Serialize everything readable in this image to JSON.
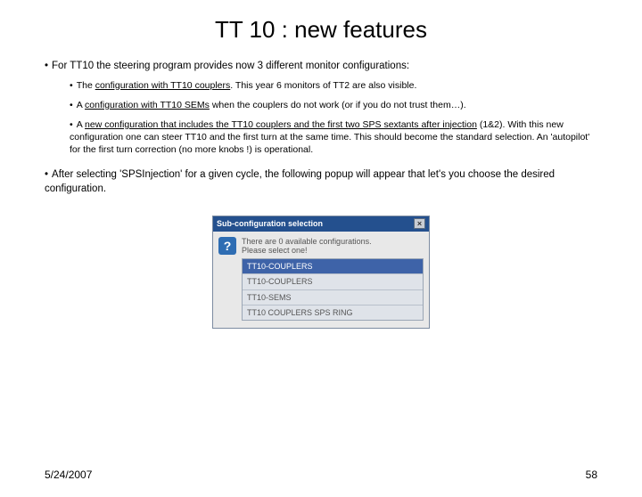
{
  "title": "TT 10 : new features",
  "bullets": {
    "b1": "For TT10 the steering program provides now 3 different monitor configurations:",
    "b1a_pre": "The ",
    "b1a_u": "configuration with TT10 couplers",
    "b1a_post": ". This year 6 monitors of TT2 are also visible.",
    "b1b_pre": "A ",
    "b1b_u": "configuration with TT10 SEMs",
    "b1b_post": " when the couplers do not work (or if you do not trust them…).",
    "b1c_pre": "A ",
    "b1c_u": "new configuration that includes the TT10 couplers and the first two SPS sextants after injection",
    "b1c_post": " (1&2). With this new configuration one can steer TT10 and the first turn at the same time. This should become the standard selection. An 'autopilot' for the first turn correction (no more knobs !) is operational.",
    "b2": "After selecting 'SPSInjection' for a given cycle, the following popup will appear that let's you choose the desired configuration."
  },
  "dialog": {
    "title": "Sub-configuration selection",
    "close": "×",
    "qmark": "?",
    "msg1": "There are 0 available configurations.",
    "msg2": "Please select one!",
    "options": [
      "TT10-COUPLERS",
      "TT10-COUPLERS",
      "TT10-SEMS",
      "TT10 COUPLERS SPS RING"
    ],
    "selected": 0
  },
  "footer": {
    "date": "5/24/2007",
    "page": "58"
  }
}
